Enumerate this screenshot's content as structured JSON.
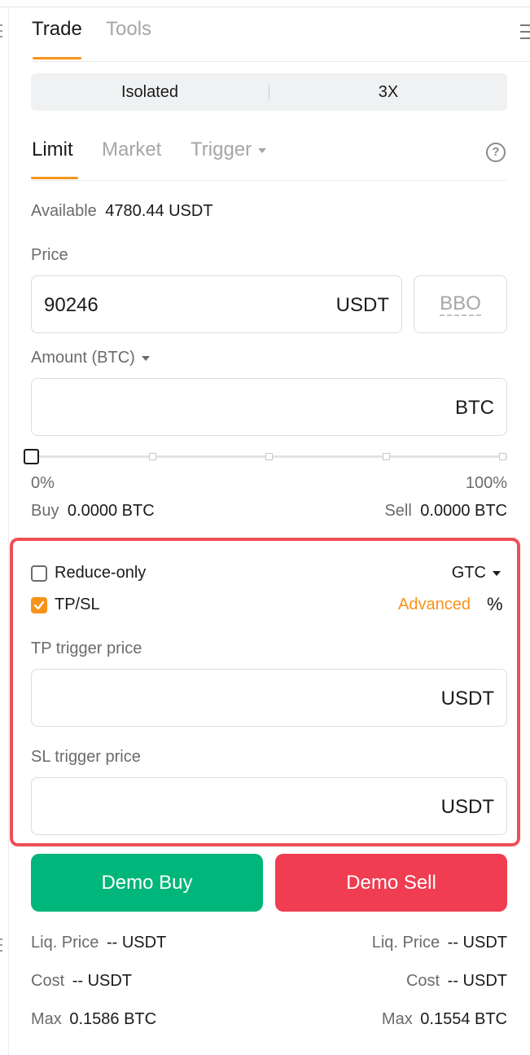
{
  "tabs": {
    "trade": "Trade",
    "tools": "Tools"
  },
  "margin": {
    "mode": "Isolated",
    "leverage": "3X"
  },
  "order_types": {
    "limit": "Limit",
    "market": "Market",
    "trigger": "Trigger"
  },
  "help_glyph": "?",
  "available": {
    "label": "Available",
    "value": "4780.44 USDT"
  },
  "price": {
    "label": "Price",
    "value": "90246",
    "unit": "USDT",
    "bbo": "BBO"
  },
  "amount": {
    "label": "Amount (BTC)",
    "value": "",
    "unit": "BTC"
  },
  "slider": {
    "min": "0%",
    "max": "100%",
    "percent": 0
  },
  "buy_qty": {
    "label": "Buy",
    "value": "0.0000 BTC"
  },
  "sell_qty": {
    "label": "Sell",
    "value": "0.0000 BTC"
  },
  "options": {
    "reduce_only": {
      "label": "Reduce-only",
      "checked": false
    },
    "tif": "GTC",
    "tpsl": {
      "label": "TP/SL",
      "checked": true
    },
    "advanced": "Advanced",
    "percent_icon": "%"
  },
  "tp": {
    "label": "TP trigger price",
    "unit": "USDT",
    "value": ""
  },
  "sl": {
    "label": "SL trigger price",
    "unit": "USDT",
    "value": ""
  },
  "buttons": {
    "buy": "Demo Buy",
    "sell": "Demo Sell"
  },
  "stats": {
    "left": {
      "liq_label": "Liq. Price",
      "liq_value": "-- USDT",
      "cost_label": "Cost",
      "cost_value": "-- USDT",
      "max_label": "Max",
      "max_value": "0.1586 BTC"
    },
    "right": {
      "liq_label": "Liq. Price",
      "liq_value": "-- USDT",
      "cost_label": "Cost",
      "cost_value": "-- USDT",
      "max_label": "Max",
      "max_value": "0.1554 BTC"
    }
  },
  "colors": {
    "accent": "#f7931a",
    "buy": "#00b67a",
    "sell": "#f03d52",
    "highlight": "#ef4f55"
  }
}
